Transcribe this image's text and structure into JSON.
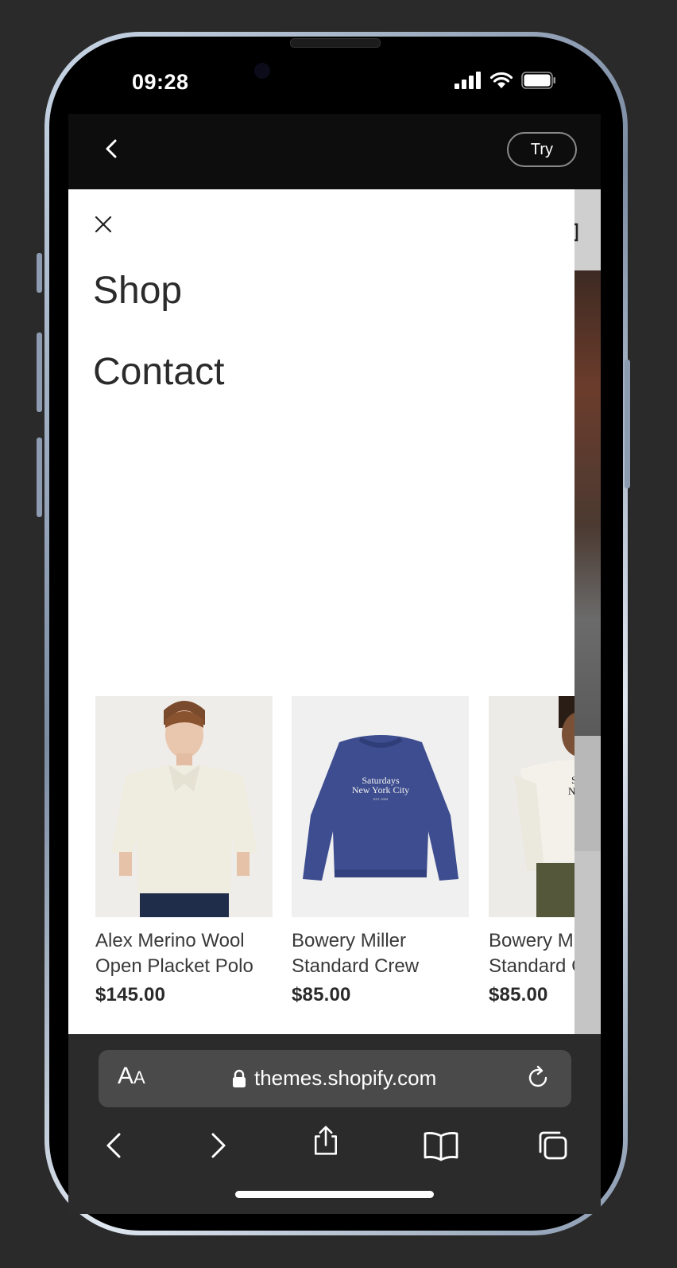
{
  "status": {
    "time": "09:28"
  },
  "topbar": {
    "try_label": "Try"
  },
  "drawer": {
    "menu": [
      {
        "label": "Shop"
      },
      {
        "label": "Contact"
      }
    ],
    "products": [
      {
        "name_line1": "Alex Merino Wool",
        "name_line2": "Open Placket Polo",
        "price": "$145.00"
      },
      {
        "name_line1": "Bowery Miller",
        "name_line2": "Standard Crew",
        "price": "$85.00"
      },
      {
        "name_line1": "Bowery Miller",
        "name_line2": "Standard Crew",
        "price": "$85.00"
      }
    ],
    "sweatshirt_print": {
      "line1": "Saturdays",
      "line2": "New York City",
      "line3": "EST. 2009"
    }
  },
  "browser": {
    "aa_large": "A",
    "aa_small": "A",
    "url": "themes.shopify.com"
  },
  "colors": {
    "sweatshirt_blue": "#3d4d8f",
    "polo_cream": "#efece0",
    "background": "#2a2a2a"
  }
}
